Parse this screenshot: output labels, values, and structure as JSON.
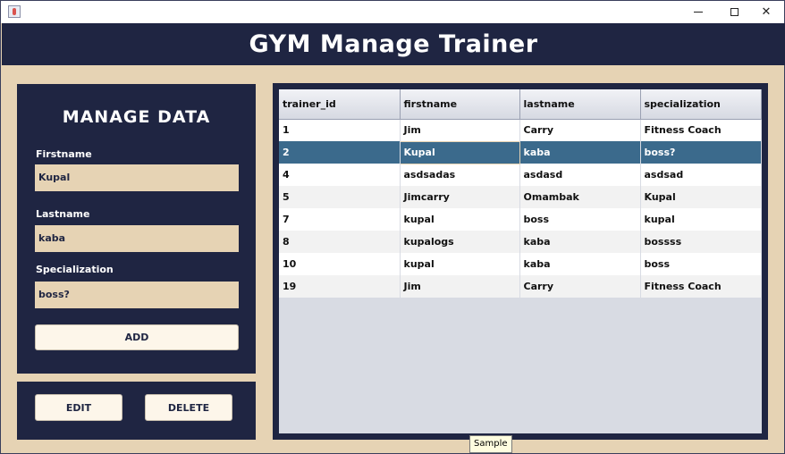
{
  "window": {
    "icon": "java-coffee-cup-icon",
    "controls": {
      "minimize": "minimize-icon",
      "maximize": "maximize-icon",
      "close": "✕"
    }
  },
  "header": {
    "title": "GYM Manage Trainer"
  },
  "form": {
    "title": "MANAGE DATA",
    "firstname_label": "Firstname",
    "firstname_value": "Kupal",
    "lastname_label": "Lastname",
    "lastname_value": "kaba",
    "specialization_label": "Specialization",
    "specialization_value": "boss?",
    "add_label": "ADD"
  },
  "actions": {
    "edit_label": "EDIT",
    "delete_label": "DELETE"
  },
  "table": {
    "columns": [
      "trainer_id",
      "firstname",
      "lastname",
      "specialization"
    ],
    "rows": [
      [
        "1",
        "Jim",
        "Carry",
        " Fitness Coach"
      ],
      [
        "2",
        "Kupal",
        "kaba",
        "boss?"
      ],
      [
        "4",
        "asdsadas",
        "asdasd",
        "asdsad"
      ],
      [
        "5",
        "Jimcarry",
        "Omambak",
        " Kupal"
      ],
      [
        "7",
        "kupal",
        "boss",
        " kupal"
      ],
      [
        "8",
        "kupalogs",
        "kaba",
        " bossss"
      ],
      [
        "10",
        "kupal",
        "kaba",
        "boss"
      ],
      [
        "19",
        "Jim",
        "Carry",
        " Fitness Coach"
      ]
    ],
    "selected_row": 1
  },
  "tooltip": "Sample",
  "colors": {
    "navy": "#1f2542",
    "beige": "#e6d3b4",
    "selection": "#3b6a8c"
  }
}
